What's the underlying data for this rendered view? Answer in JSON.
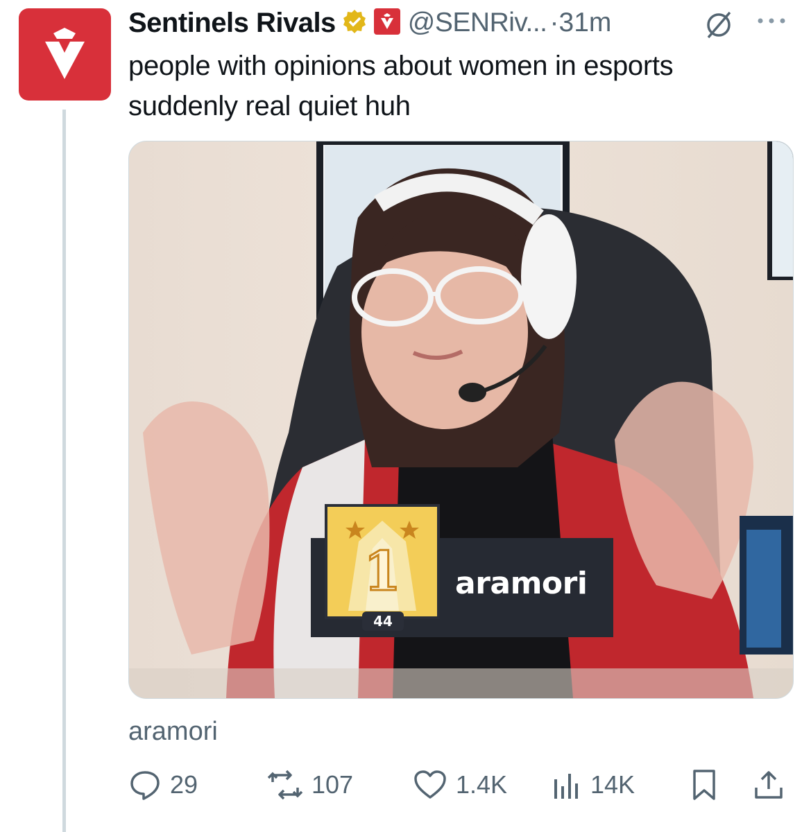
{
  "tweet": {
    "display_name": "Sentinels Rivals",
    "handle": "@SENRiv...",
    "time": "·31m",
    "text_line1": "people with opinions about women in esports",
    "text_line2": "suddenly real quiet huh",
    "media_caption": "aramori"
  },
  "media_overlay": {
    "player_name": "aramori",
    "level": "44"
  },
  "actions": {
    "replies": "29",
    "reposts": "107",
    "likes": "1.4K",
    "views": "14K"
  },
  "icons": {
    "verified": "verified-badge-icon",
    "affiliate": "sentinels-affiliate-icon",
    "grok": "grok-icon",
    "more": "more-icon",
    "reply": "reply-icon",
    "repost": "repost-icon",
    "like": "like-icon",
    "views": "views-icon",
    "bookmark": "bookmark-icon",
    "share": "share-icon"
  },
  "colors": {
    "brand_red": "#d8303a",
    "verified_gold": "#e2b719",
    "secondary_text": "#536471"
  }
}
